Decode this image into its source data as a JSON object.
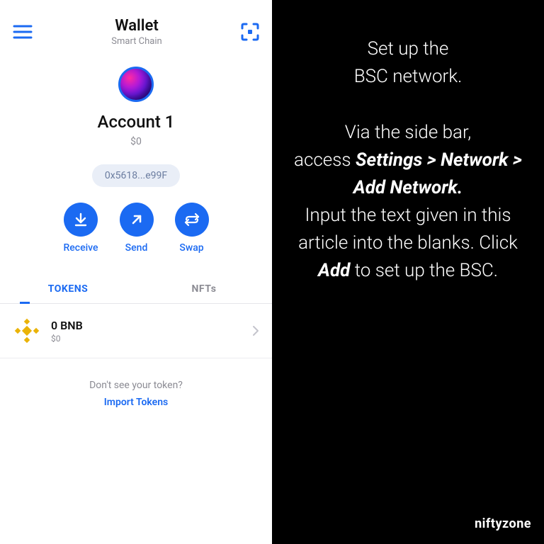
{
  "header": {
    "title": "Wallet",
    "subtitle": "Smart Chain"
  },
  "account": {
    "name": "Account 1",
    "balance": "$0",
    "address": "0x5618...e99F"
  },
  "actions": {
    "receive": "Receive",
    "send": "Send",
    "swap": "Swap"
  },
  "tabs": {
    "tokens": "TOKENS",
    "nfts": "NFTs"
  },
  "tokens": [
    {
      "name": "0 BNB",
      "fiat": "$0"
    }
  ],
  "import": {
    "prompt": "Don't see your token?",
    "link": "Import Tokens"
  },
  "instructions": {
    "line1": "Set up the",
    "line2": "BSC network.",
    "p2a": "Via the side bar,",
    "p2b": "access ",
    "nav": "Settings > Network > Add Network.",
    "p3a": "Input the text given in this article into the blanks. Click ",
    "add": "Add",
    "p3b": " to set up the BSC."
  },
  "brand": "niftyzone"
}
